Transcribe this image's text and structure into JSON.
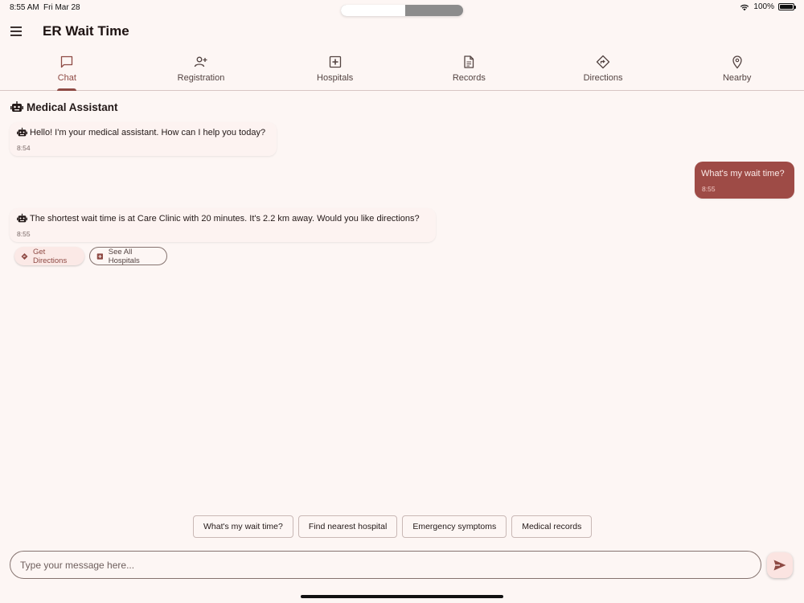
{
  "status_bar": {
    "time": "8:55 AM",
    "date": "Fri Mar 28",
    "battery": "100%"
  },
  "app": {
    "title": "ER Wait Time"
  },
  "tabs": [
    {
      "label": "Chat",
      "icon": "chat-icon",
      "active": true
    },
    {
      "label": "Registration",
      "icon": "person-add-icon",
      "active": false
    },
    {
      "label": "Hospitals",
      "icon": "hospital-icon",
      "active": false
    },
    {
      "label": "Records",
      "icon": "document-icon",
      "active": false
    },
    {
      "label": "Directions",
      "icon": "directions-icon",
      "active": false
    },
    {
      "label": "Nearby",
      "icon": "location-pin-icon",
      "active": false
    }
  ],
  "chat": {
    "header": "Medical Assistant",
    "messages": [
      {
        "from": "bot",
        "text": "Hello! I'm your medical assistant. How can I help you today?",
        "time": "8:54"
      },
      {
        "from": "user",
        "text": "What's my wait time?",
        "time": "8:55"
      },
      {
        "from": "bot",
        "text": "The shortest wait time is at Care Clinic with 20 minutes. It's 2.2 km away. Would you like directions?",
        "time": "8:55"
      }
    ],
    "actions": [
      {
        "label": "Get Directions",
        "icon": "directions-icon"
      },
      {
        "label": "See All Hospitals",
        "icon": "hospital-icon"
      }
    ]
  },
  "suggestions": [
    "What's my wait time?",
    "Find nearest hospital",
    "Emergency symptoms",
    "Medical records"
  ],
  "input": {
    "placeholder": "Type your message here...",
    "value": ""
  },
  "colors": {
    "accent": "#8e4a44",
    "user_bubble": "#9e4b46",
    "background": "#fdf6f4"
  }
}
